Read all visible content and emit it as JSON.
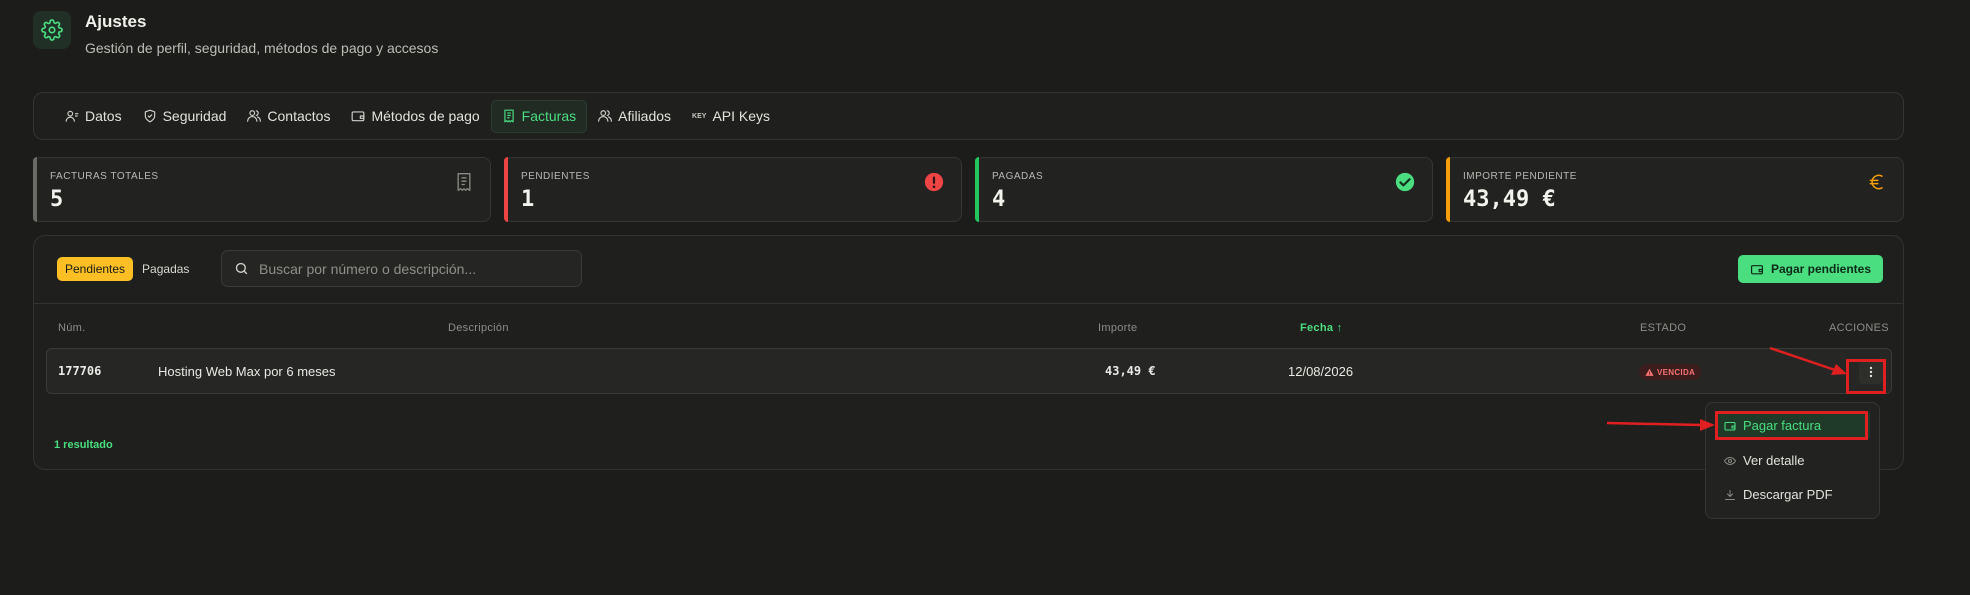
{
  "header": {
    "title": "Ajustes",
    "subtitle": "Gestión de perfil, seguridad, métodos de pago y accesos",
    "icon": "gear-icon"
  },
  "tabs": [
    {
      "label": "Datos",
      "icon": "user-icon",
      "active": false
    },
    {
      "label": "Seguridad",
      "icon": "shield-icon",
      "active": false
    },
    {
      "label": "Contactos",
      "icon": "users-icon",
      "active": false
    },
    {
      "label": "Métodos de pago",
      "icon": "wallet-icon",
      "active": false
    },
    {
      "label": "Facturas",
      "icon": "receipt-icon",
      "active": true
    },
    {
      "label": "Afiliados",
      "icon": "user-plus-icon",
      "active": false
    },
    {
      "label": "API Keys",
      "icon": "key-icon",
      "active": false
    }
  ],
  "tab_key_text": "KEY",
  "stats": [
    {
      "label": "FACTURAS TOTALES",
      "value": "5",
      "color": "#6b6b66",
      "icon": "receipt-icon"
    },
    {
      "label": "PENDIENTES",
      "value": "1",
      "color": "#ef4444",
      "icon": "alert-icon"
    },
    {
      "label": "PAGADAS",
      "value": "4",
      "color": "#22c55e",
      "icon": "check-circle-icon"
    },
    {
      "label": "IMPORTE PENDIENTE",
      "value": "43,49 €",
      "color": "#f59e0b",
      "icon": "euro-icon"
    }
  ],
  "filters": {
    "active": "Pendientes",
    "inactive": "Pagadas"
  },
  "search": {
    "placeholder": "Buscar por número o descripción...",
    "value": ""
  },
  "pay_pending_label": "Pagar pendientes",
  "table": {
    "headers": {
      "num": "Núm.",
      "descripcion": "Descripción",
      "importe": "Importe",
      "fecha": "Fecha ↑",
      "estado": "ESTADO",
      "acciones": "ACCIONES"
    },
    "rows": [
      {
        "num": "177706",
        "descripcion": "Hosting Web Max por 6 meses",
        "importe": "43,49 €",
        "fecha": "12/08/2026",
        "estado": "VENCIDA"
      }
    ],
    "result_count": "1 resultado"
  },
  "row_menu": {
    "items": [
      {
        "label": "Pagar factura",
        "icon": "wallet-icon",
        "highlighted": true
      },
      {
        "label": "Ver detalle",
        "icon": "eye-icon",
        "highlighted": false
      },
      {
        "label": "Descargar PDF",
        "icon": "download-icon",
        "highlighted": false
      }
    ]
  },
  "colors": {
    "accent": "#4ade80",
    "warning": "#fbbf24",
    "danger": "#ef4444",
    "annotation": "#e02020",
    "background": "#1c1c1a"
  }
}
